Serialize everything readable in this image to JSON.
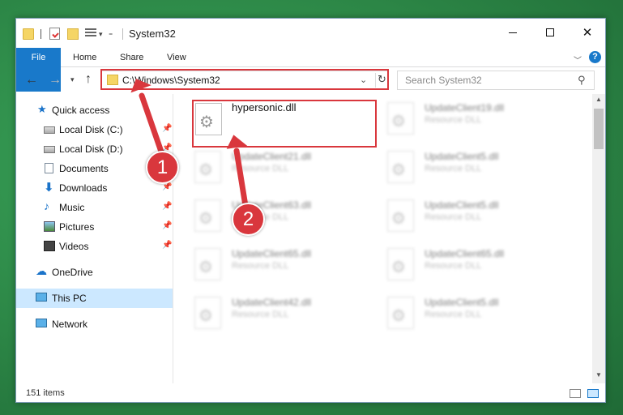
{
  "window": {
    "title": "System32"
  },
  "ribbon": {
    "tabs": [
      "File",
      "Home",
      "Share",
      "View"
    ],
    "help": "?"
  },
  "address": {
    "path": "C:\\Windows\\System32",
    "search_placeholder": "Search System32"
  },
  "sidebar": {
    "items": [
      {
        "label": "Quick access",
        "icon": "star-icon"
      },
      {
        "label": "Local Disk (C:)",
        "icon": "drive-icon",
        "pinned": true
      },
      {
        "label": "Local Disk (D:)",
        "icon": "drive-icon",
        "pinned": true
      },
      {
        "label": "Documents",
        "icon": "documents-icon",
        "pinned": true
      },
      {
        "label": "Downloads",
        "icon": "download-icon",
        "pinned": true
      },
      {
        "label": "Music",
        "icon": "music-icon",
        "pinned": true
      },
      {
        "label": "Pictures",
        "icon": "pictures-icon",
        "pinned": true
      },
      {
        "label": "Videos",
        "icon": "videos-icon",
        "pinned": true
      },
      {
        "label": "OneDrive",
        "icon": "cloud-icon"
      },
      {
        "label": "This PC",
        "icon": "computer-icon",
        "selected": true
      },
      {
        "label": "Network",
        "icon": "network-icon"
      }
    ]
  },
  "files": {
    "items": [
      {
        "name": "hypersonic.dll",
        "type": ""
      },
      {
        "name": "UpdateClient19.dll",
        "type": "Resource DLL"
      },
      {
        "name": "UpdateClient21.dll",
        "type": "Resource DLL"
      },
      {
        "name": "UpdateClient5.dll",
        "type": "Resource DLL"
      },
      {
        "name": "UpdateClient63.dll",
        "type": "Resource DLL"
      },
      {
        "name": "UpdateClient5.dll",
        "type": "Resource DLL"
      },
      {
        "name": "UpdateClient65.dll",
        "type": "Resource DLL"
      },
      {
        "name": "UpdateClient65.dll",
        "type": "Resource DLL"
      },
      {
        "name": "UpdateClient42.dll",
        "type": "Resource DLL"
      },
      {
        "name": "UpdateClient5.dll",
        "type": "Resource DLL"
      }
    ]
  },
  "status": {
    "count": "151 items"
  },
  "annotations": {
    "step1": "1",
    "step2": "2"
  },
  "colors": {
    "accent": "#1979ca",
    "highlight": "#d9373d",
    "selection": "#cce8ff"
  }
}
